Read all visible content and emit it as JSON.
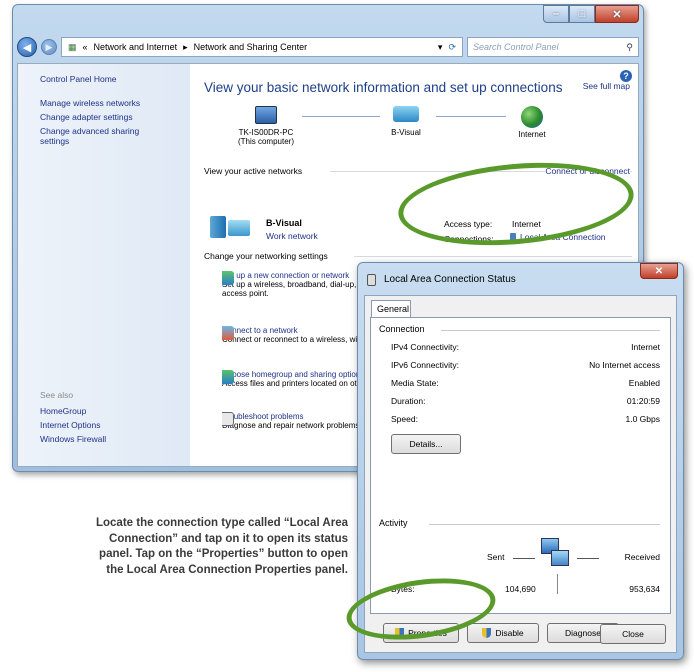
{
  "window": {
    "breadcrumb": [
      "«",
      "Network and Internet",
      "▸",
      "Network and Sharing Center"
    ],
    "search_placeholder": "Search Control Panel",
    "left": {
      "home": "Control Panel Home",
      "links": [
        "Manage wireless networks",
        "Change adapter settings",
        "Change advanced sharing settings"
      ],
      "see_also": "See also",
      "see_links": [
        "HomeGroup",
        "Internet Options",
        "Windows Firewall"
      ]
    },
    "title": "View your basic network information and set up connections",
    "see_full_map": "See full map",
    "map": {
      "computer": "TK-IS00DR-PC",
      "computer_sub": "(This computer)",
      "network": "B-Visual",
      "internet": "Internet"
    },
    "active_networks": "View your active networks",
    "connect_disconnect": "Connect or disconnect",
    "network_name": "B-Visual",
    "network_type": "Work network",
    "access_type_label": "Access type:",
    "access_type_value": "Internet",
    "connections_label": "Connections:",
    "connections_value": "Local Area Connection",
    "change_settings": "Change your networking settings",
    "settings_items": [
      {
        "title": "Set up a new connection or network",
        "desc": "Set up a wireless, broadband, dial-up, ad hoc, or VPN connection; or set up a router or",
        "desc2": "access point."
      },
      {
        "title": "Connect to a network",
        "desc": "Connect or reconnect to a wireless, wired, dial-up, or VPN network connection."
      },
      {
        "title": "Choose homegroup and sharing options",
        "desc": "Access files and printers located on other network computers, or change sharing settings."
      },
      {
        "title": "Troubleshoot problems",
        "desc": "Diagnose and repair network problems, or get troubleshooting information."
      }
    ]
  },
  "dialog": {
    "title": "Local Area Connection Status",
    "tab": "General",
    "connection_group": "Connection",
    "rows": [
      {
        "label": "IPv4 Connectivity:",
        "value": "Internet"
      },
      {
        "label": "IPv6 Connectivity:",
        "value": "No Internet access"
      },
      {
        "label": "Media State:",
        "value": "Enabled"
      },
      {
        "label": "Duration:",
        "value": "01:20:59"
      },
      {
        "label": "Speed:",
        "value": "1.0 Gbps"
      }
    ],
    "details_button": "Details...",
    "activity_group": "Activity",
    "sent_label": "Sent",
    "received_label": "Received",
    "bytes_label": "Bytes:",
    "bytes_sent": "104,690",
    "bytes_received": "953,634",
    "properties_button": "Properties",
    "disable_button": "Disable",
    "diagnose_button": "Diagnose",
    "close_button": "Close"
  },
  "caption": "Locate the connection type called “Local Area Connection” and tap on it to open its status panel. Tap on the “Properties” button to open the Local Area Connection Properties panel.",
  "colors": {
    "highlight_ring": "#5a9a2a",
    "link": "#1e3287",
    "title": "#1e3f8a"
  }
}
